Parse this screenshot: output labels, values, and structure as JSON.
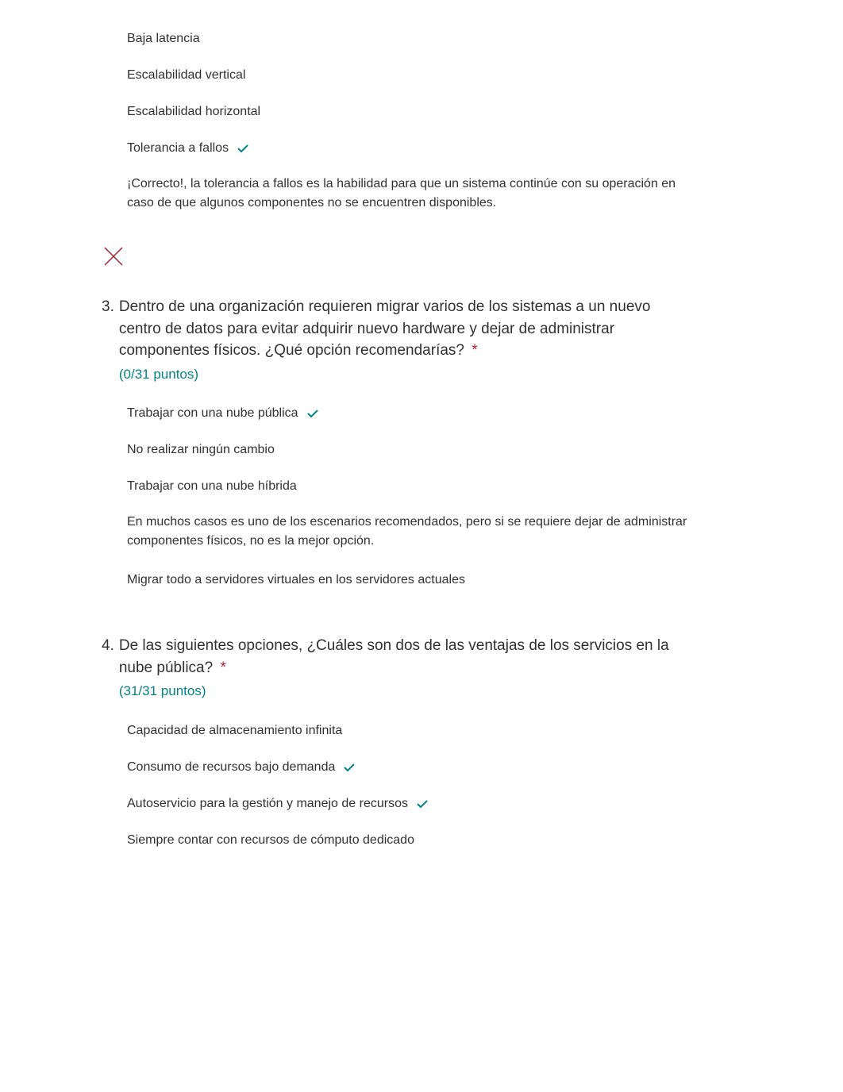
{
  "q2_tail": {
    "options": [
      {
        "label": "Baja latencia",
        "correct": false
      },
      {
        "label": "Escalabilidad vertical",
        "correct": false
      },
      {
        "label": "Escalabilidad horizontal",
        "correct": false
      },
      {
        "label": "Tolerancia a fallos",
        "correct": true
      }
    ],
    "feedback": "¡Correcto!, la tolerancia a fallos es la habilidad para que un sistema continúe con su operación en caso de que algunos componentes no se encuentren disponibles."
  },
  "q3": {
    "number": "3.",
    "text": "Dentro de una organización requieren migrar varios de los sistemas a un nuevo centro de datos para evitar adquirir nuevo hardware y dejar de administrar componentes físicos. ¿Qué opción recomendarías?",
    "required": "*",
    "points": "(0/31 puntos)",
    "options": [
      {
        "label": "Trabajar con una nube pública",
        "correct": true
      },
      {
        "label": "No realizar ningún cambio",
        "correct": false
      },
      {
        "label": "Trabajar con una nube híbrida",
        "correct": false
      }
    ],
    "explain": "En muchos casos es uno de los escenarios recomendados, pero si se requiere dejar de administrar componentes físicos, no es la mejor opción.",
    "options_after": [
      {
        "label": "Migrar todo a servidores virtuales en los servidores actuales",
        "correct": false
      }
    ]
  },
  "q4": {
    "number": "4.",
    "text": "De las siguientes opciones, ¿Cuáles son dos de las ventajas de los servicios en la nube pública?",
    "required": "*",
    "points": "(31/31 puntos)",
    "options": [
      {
        "label": "Capacidad de almacenamiento infinita",
        "correct": false
      },
      {
        "label": "Consumo de recursos bajo demanda",
        "correct": true
      },
      {
        "label": "Autoservicio para la gestión y manejo de recursos",
        "correct": true
      },
      {
        "label": "Siempre contar con recursos de cómputo dedicado",
        "correct": false
      }
    ]
  }
}
